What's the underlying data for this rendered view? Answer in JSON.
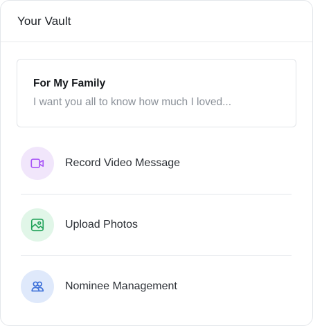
{
  "vault": {
    "title": "Your Vault",
    "note": {
      "title": "For My Family",
      "preview": "I want you all to know how much I loved..."
    },
    "actions": [
      {
        "label": "Record Video Message",
        "icon": "video-camera-icon",
        "color": "#a855f7"
      },
      {
        "label": "Upload Photos",
        "icon": "image-icon",
        "color": "#22a25a"
      },
      {
        "label": "Nominee Management",
        "icon": "users-icon",
        "color": "#3b6fd8"
      }
    ]
  }
}
